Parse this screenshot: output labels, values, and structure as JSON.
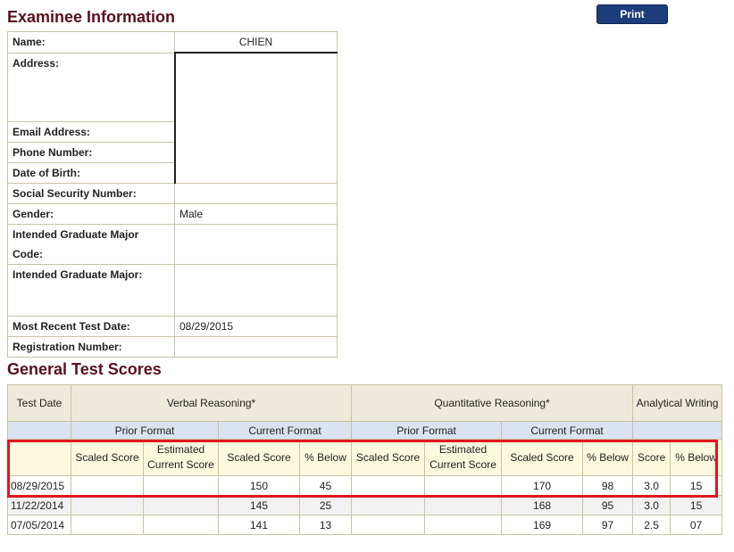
{
  "examinee": {
    "title": "Examinee Information",
    "print_label": "Print",
    "labels": {
      "name": "Name:",
      "address": "Address:",
      "email": "Email Address:",
      "phone": "Phone Number:",
      "dob": "Date of Birth:",
      "ssn": "Social Security Number:",
      "gender": "Gender:",
      "major_code": "Intended Graduate Major Code:",
      "major": "Intended Graduate Major:",
      "test_date": "Most Recent Test Date:",
      "registration": "Registration Number:"
    },
    "values": {
      "name": "CHIEN",
      "gender": "Male",
      "test_date": "08/29/2015"
    }
  },
  "scores": {
    "title": "General Test Scores",
    "headers": {
      "test_date": "Test Date",
      "verbal": "Verbal Reasoning*",
      "quant": "Quantitative Reasoning*",
      "analytical": "Analytical Writing",
      "prior_format": "Prior Format",
      "current_format": "Current Format",
      "scaled_score": "Scaled Score",
      "estimated_current_score": "Estimated Current Score",
      "pct_below": "% Below",
      "score": "Score"
    },
    "rows": [
      {
        "date": "08/29/2015",
        "v_prior_scaled": "",
        "v_prior_est": "",
        "v_scaled": "150",
        "v_pct": "45",
        "q_prior_scaled": "",
        "q_prior_est": "",
        "q_scaled": "170",
        "q_pct": "98",
        "a_score": "3.0",
        "a_pct": "15"
      },
      {
        "date": "11/22/2014",
        "v_prior_scaled": "",
        "v_prior_est": "",
        "v_scaled": "145",
        "v_pct": "25",
        "q_prior_scaled": "",
        "q_prior_est": "",
        "q_scaled": "168",
        "q_pct": "95",
        "a_score": "3.0",
        "a_pct": "15"
      },
      {
        "date": "07/05/2014",
        "v_prior_scaled": "",
        "v_prior_est": "",
        "v_scaled": "141",
        "v_pct": "13",
        "q_prior_scaled": "",
        "q_prior_est": "",
        "q_scaled": "169",
        "q_pct": "97",
        "a_score": "2.5",
        "a_pct": "07"
      }
    ]
  },
  "colors": {
    "title": "#5a1020",
    "button": "#1c3d7a",
    "highlight": "#e0151f"
  }
}
